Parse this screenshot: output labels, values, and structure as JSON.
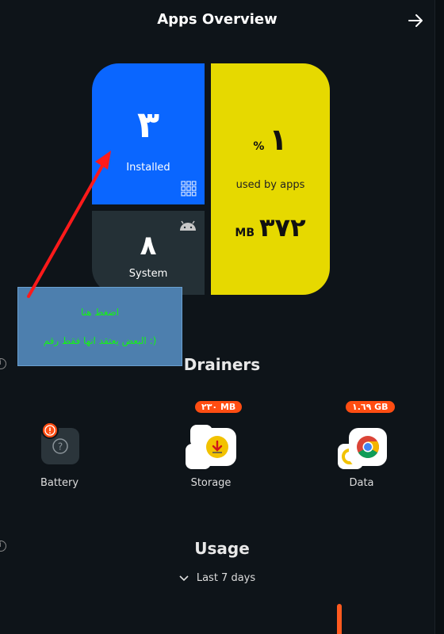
{
  "header": {
    "title": "Apps Overview",
    "action_icon": "arrow-right-icon"
  },
  "overview": {
    "installed": {
      "count": "٣",
      "label": "Installed",
      "icon": "grid-icon"
    },
    "system": {
      "count": "٨",
      "label": "System",
      "icon": "android-icon"
    },
    "storage": {
      "percent": "١",
      "percent_unit": "%",
      "label": "used by apps",
      "size": "٣٧٢",
      "size_unit": "MB"
    }
  },
  "annotation": {
    "line1": "اضغط هنا",
    "line2": "البعض يعتقد انها فقط رقم :)",
    "color": "#16f216"
  },
  "drainers": {
    "title": "Drainers",
    "items": [
      {
        "label": "Battery",
        "icon": "battery-app-icon"
      },
      {
        "label": "Storage",
        "icon": "storage-app-icon",
        "badge": "٢٣٠ MB"
      },
      {
        "label": "Data",
        "icon": "chrome-icon",
        "badge": "١.٦٩ GB"
      }
    ]
  },
  "usage": {
    "title": "Usage",
    "range": "Last 7 days"
  },
  "colors": {
    "installed": "#0a66ff",
    "system": "#243036",
    "storage": "#e6d900",
    "badge": "#ff4d12",
    "background": "#0e1419"
  }
}
